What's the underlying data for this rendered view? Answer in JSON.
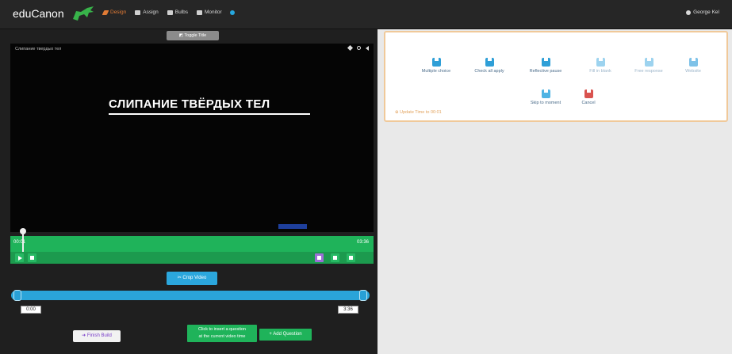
{
  "app": {
    "brand": "eduCanon",
    "user": "George Kel"
  },
  "nav": [
    {
      "label": "Design",
      "active": true
    },
    {
      "label": "Assign",
      "active": false
    },
    {
      "label": "Bulbs",
      "active": false
    },
    {
      "label": "Monitor",
      "active": false
    }
  ],
  "editor": {
    "toggle_label": "◩ Toggle Title",
    "video": {
      "title": "Слипание твердых тел",
      "heading": "СЛИПАНИЕ ТВЁРДЫХ ТЕЛ"
    },
    "timeline": {
      "current": "00:01",
      "end": "03:36"
    },
    "crop_label": "✂ Crop Video",
    "range": {
      "start": "0:00",
      "end": "3:36"
    },
    "finish_label": "➜ Finish Build",
    "hint_line1": "Click to insert a question",
    "hint_line2": "at the current video time",
    "add_question_label": "+ Add Question"
  },
  "question_types": [
    {
      "label": "Multiple choice",
      "color": "#2f9fd7",
      "faded": false
    },
    {
      "label": "Check all apply",
      "color": "#2f9fd7",
      "faded": false
    },
    {
      "label": "Reflective pause",
      "color": "#2f9fd7",
      "faded": false
    },
    {
      "label": "Fill in blank",
      "color": "#9dd3ef",
      "faded": true
    },
    {
      "label": "Free response",
      "color": "#9dd3ef",
      "faded": true
    },
    {
      "label": "Website",
      "color": "#7ec2e8",
      "faded": true
    },
    {
      "label": "Skip to moment",
      "color": "#4fb4e4",
      "faded": false
    },
    {
      "label": "Cancel",
      "color": "#d9534f",
      "faded": false
    }
  ],
  "update_time": "⊕ Update Time to 00:01",
  "colors": {
    "timeline": "#1fb35a",
    "range": "#2aa4d9",
    "accent": "#e07b35"
  }
}
